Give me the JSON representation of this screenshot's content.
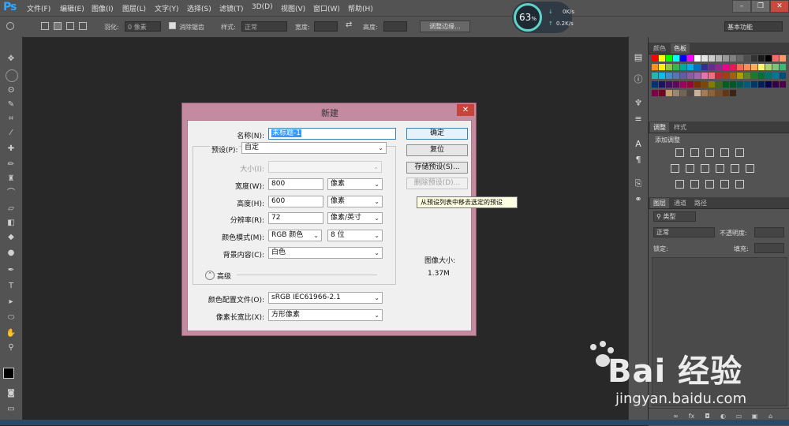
{
  "app": {
    "logo": "Ps"
  },
  "menu": [
    "文件(F)",
    "编辑(E)",
    "图像(I)",
    "图层(L)",
    "文字(Y)",
    "选择(S)",
    "滤镜(T)",
    "3D(D)",
    "视图(V)",
    "窗口(W)",
    "帮助(H)"
  ],
  "options": {
    "feather_label": "羽化:",
    "feather_value": "0 像素",
    "antialias_label": "消除锯齿",
    "style_label": "样式:",
    "style_value": "正常",
    "width_label": "宽度:",
    "height_label": "高度:",
    "refine_button": "调整边缘...",
    "workspace": "基本功能"
  },
  "gauge": {
    "percent": "63",
    "unit": "%",
    "down": "0K/s",
    "up": "0.2K/s"
  },
  "panels": {
    "color_tab": "颜色",
    "swatches_tab": "色板",
    "adjust_tab": "调整",
    "styles_tab": "样式",
    "adjust_title": "添加调整",
    "layers_tab": "图层",
    "channels_tab": "通道",
    "paths_tab": "路径",
    "kind": "类型",
    "blend": "正常",
    "opacity_label": "不透明度:",
    "lock_label": "锁定:",
    "fill_label": "填充:"
  },
  "dialog": {
    "title": "新建",
    "name_label": "名称(N):",
    "name_value": "未标题-1",
    "preset_label": "预设(P):",
    "preset_value": "自定",
    "size_label": "大小(I):",
    "width_label": "宽度(W):",
    "width_value": "800",
    "width_unit": "像素",
    "height_label": "高度(H):",
    "height_value": "600",
    "height_unit": "像素",
    "resolution_label": "分辨率(R):",
    "resolution_value": "72",
    "resolution_unit": "像素/英寸",
    "colormode_label": "颜色模式(M):",
    "colormode_value": "RGB 颜色",
    "bitdepth_value": "8 位",
    "background_label": "背景内容(C):",
    "background_value": "白色",
    "advanced_label": "高级",
    "profile_label": "颜色配置文件(O):",
    "profile_value": "sRGB IEC61966-2.1",
    "aspect_label": "像素长宽比(X):",
    "aspect_value": "方形像素",
    "ok_button": "确定",
    "reset_button": "复位",
    "save_preset_button": "存储预设(S)...",
    "delete_preset_button": "删除预设(D)...",
    "image_size_label": "图像大小:",
    "image_size_value": "1.37M",
    "tooltip": "从预设列表中移去选定的预设"
  },
  "watermark": {
    "brand": "Bai 经验",
    "url": "jingyan.baidu.com"
  },
  "colors": {
    "swatches": [
      "#ff0000",
      "#ffff00",
      "#00ff00",
      "#00ffff",
      "#0000ff",
      "#ff00ff",
      "#ffffff",
      "#e6e6e6",
      "#cccccc",
      "#b3b3b3",
      "#999999",
      "#808080",
      "#666666",
      "#4d4d4d",
      "#333333",
      "#1a1a1a",
      "#000000",
      "#ff6666",
      "#ff9966",
      "#f7941d",
      "#fff200",
      "#8dc63f",
      "#39b54a",
      "#00a99d",
      "#00aeef",
      "#0072bc",
      "#2e3192",
      "#662d91",
      "#92278f",
      "#ec008c",
      "#ed145b",
      "#f26c4f",
      "#f68e56",
      "#fbaf5d",
      "#fff568",
      "#acd373",
      "#7cc576",
      "#3bb878",
      "#1abbb4",
      "#00bff3",
      "#448ccb",
      "#5674b9",
      "#605ca8",
      "#8560a8",
      "#a864a8",
      "#f06eaa",
      "#f26d7d",
      "#c1272d",
      "#a0410d",
      "#a36209",
      "#aba000",
      "#598527",
      "#197b30",
      "#007236",
      "#00746b",
      "#0076a3",
      "#004b80",
      "#003471",
      "#1b1464",
      "#440e62",
      "#630460",
      "#9e005d",
      "#9e0039",
      "#7b2e00",
      "#7d4900",
      "#827b00",
      "#406618",
      "#005e20",
      "#005826",
      "#005952",
      "#005b7f",
      "#003663",
      "#002157",
      "#0d004c",
      "#32004b",
      "#4b0049",
      "#7b0046",
      "#7a0026",
      "#c69c6d",
      "#998675",
      "#736357",
      "#534741",
      "#c7b299",
      "#a67c52",
      "#8c6239",
      "#754c24",
      "#603913",
      "#3c2415"
    ]
  }
}
